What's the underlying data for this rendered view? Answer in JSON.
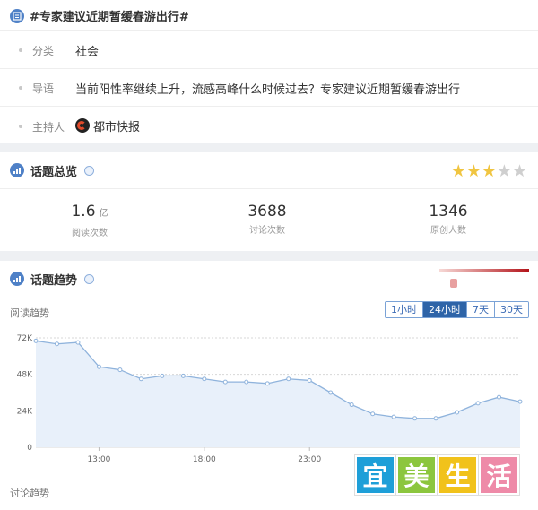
{
  "topic": {
    "title": "#专家建议近期暂缓春游出行#",
    "category_label": "分类",
    "category_value": "社会",
    "intro_label": "导语",
    "intro_value": "当前阳性率继续上升，流感高峰什么时候过去？专家建议近期暂缓春游出行",
    "host_label": "主持人",
    "host_value": "都市快报"
  },
  "overview": {
    "title": "话题总览",
    "rating": 3,
    "rating_max": 5,
    "stats": [
      {
        "value": "1.6",
        "unit": "亿",
        "label": "阅读次数"
      },
      {
        "value": "3688",
        "unit": "",
        "label": "讨论次数"
      },
      {
        "value": "1346",
        "unit": "",
        "label": "原创人数"
      }
    ]
  },
  "trend": {
    "title": "话题趋势",
    "heat_level": 0.16,
    "read_label": "阅读趋势",
    "discuss_label": "讨论趋势",
    "tabs": [
      "1小时",
      "24小时",
      "7天",
      "30天"
    ],
    "active_tab": 1
  },
  "chart_data": {
    "type": "area",
    "title": "阅读趋势",
    "x_ticks": [
      "13:00",
      "18:00",
      "23:00"
    ],
    "y_ticks": [
      "72K",
      "48K",
      "24K",
      "0"
    ],
    "ylim": [
      0,
      72000
    ],
    "grid": true,
    "series": [
      {
        "values": [
          70000,
          68000,
          69000,
          53000,
          51000,
          45000,
          47000,
          47000,
          45000,
          43000,
          43000,
          42000,
          45000,
          44000,
          36000,
          28000,
          22000,
          20000,
          19000,
          19000,
          23000,
          29000,
          33000,
          30000
        ]
      }
    ]
  },
  "watermark": [
    "宜",
    "美",
    "生",
    "活"
  ],
  "colors": {
    "accent": "#4f81c7",
    "line": "#8fb3dc",
    "fill": "#e8f0fa",
    "star": "#f0c541",
    "tab_active": "#2e64a8"
  }
}
